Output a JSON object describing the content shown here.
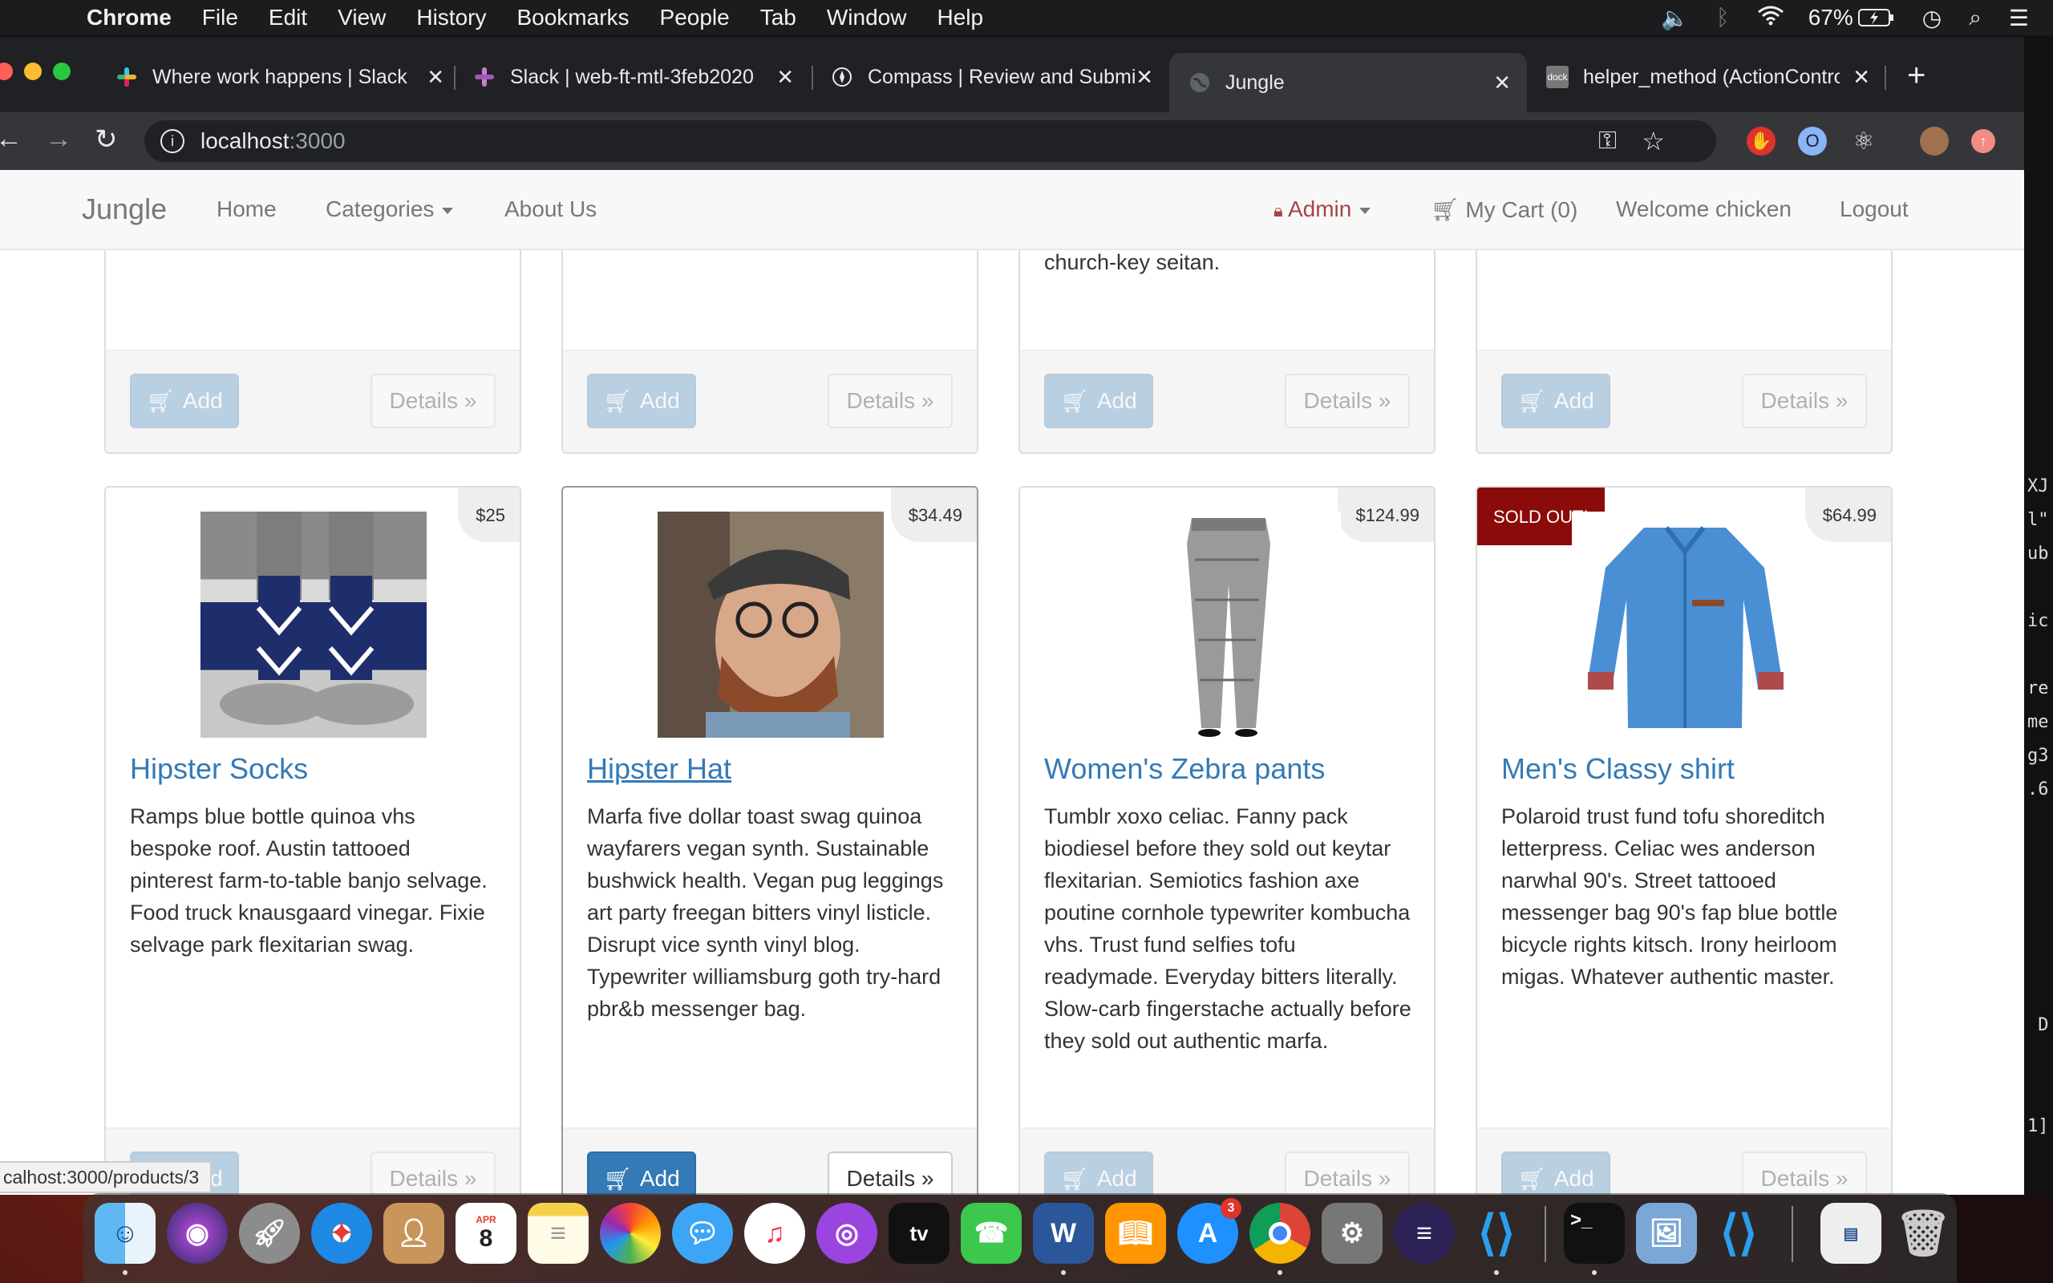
{
  "menubar": {
    "app": "Chrome",
    "items": [
      "File",
      "Edit",
      "View",
      "History",
      "Bookmarks",
      "People",
      "Tab",
      "Window",
      "Help"
    ],
    "battery": "67%"
  },
  "tabs": [
    {
      "label": "Where work happens | Slack",
      "icon": "slack-icon"
    },
    {
      "label": "Slack | web-ft-mtl-3feb2020",
      "icon": "slack-icon"
    },
    {
      "label": "Compass | Review and Submi",
      "icon": "compass-icon"
    },
    {
      "label": "Jungle",
      "icon": "globe-icon"
    },
    {
      "label": "helper_method (ActionContro",
      "icon": "docs-icon"
    }
  ],
  "address": {
    "host": "localhost",
    "port": ":3000"
  },
  "site_nav": {
    "brand": "Jungle",
    "home": "Home",
    "categories": "Categories",
    "about": "About Us",
    "admin": "Admin",
    "cart": "My Cart (0)",
    "welcome": "Welcome chicken",
    "logout": "Logout"
  },
  "top_row": {
    "card3_text_tail": "church-key seitan.",
    "add_label": "Add",
    "details_label": "Details »"
  },
  "products": [
    {
      "name": "Hipster Socks",
      "price": "$25",
      "description": "Ramps blue bottle quinoa vhs bespoke roof. Austin tattooed pinterest farm-to-table banjo selvage. Food truck knausgaard vinegar. Fixie selvage park flexitarian swag.",
      "add": "Add",
      "details": "Details »"
    },
    {
      "name": "Hipster Hat",
      "price": "$34.49",
      "description": "Marfa five dollar toast swag quinoa wayfarers vegan synth. Sustainable bushwick health. Vegan pug leggings art party freegan bitters vinyl listicle. Disrupt vice synth vinyl blog. Typewriter williamsburg goth try-hard pbr&b messenger bag.",
      "add": "Add",
      "details": "Details »"
    },
    {
      "name": "Women's Zebra pants",
      "price": "$124.99",
      "description": "Tumblr xoxo celiac. Fanny pack biodiesel before they sold out keytar flexitarian. Semiotics fashion axe poutine cornhole typewriter kombucha vhs. Trust fund selfies tofu readymade. Everyday bitters literally. Slow-carb fingerstache actually before they sold out authentic marfa.",
      "add": "Add",
      "details": "Details »"
    },
    {
      "name": "Men's Classy shirt",
      "price": "$64.99",
      "badge": "SOLD OUT!",
      "description": "Polaroid trust fund tofu shoreditch letterpress. Celiac wes anderson narwhal 90's. Street tattooed messenger bag 90's fap blue bottle bicycle rights kitsch. Irony heirloom migas. Whatever authentic master.",
      "add": "Add",
      "details": "Details »"
    }
  ],
  "status_url": "calhost:3000/products/3",
  "dock": {
    "calendar_month": "APR",
    "calendar_day": "8",
    "appstore_badge": "3",
    "tv_label": "tv",
    "word_label": "W"
  },
  "colors": {
    "link": "#337ab7",
    "sold_out": "#8b0a0a",
    "admin": "#a94442"
  }
}
